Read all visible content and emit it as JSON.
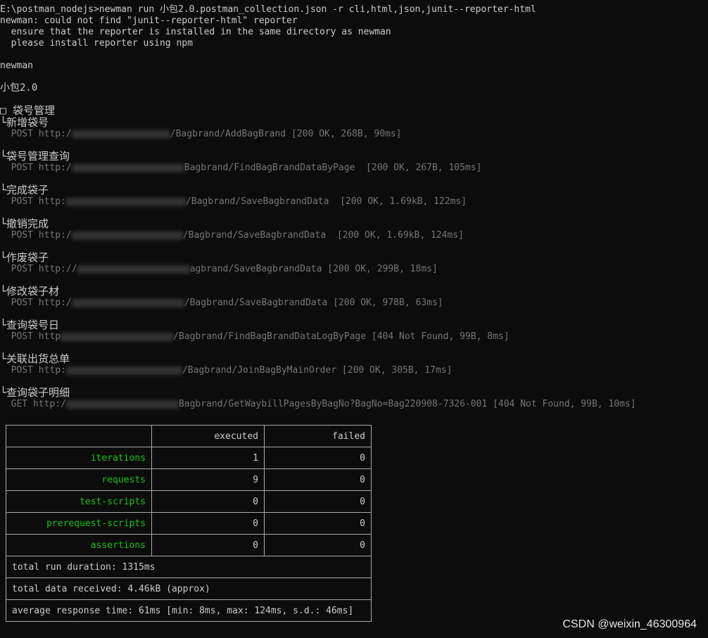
{
  "header": {
    "command": "E:\\postman_nodejs>newman run 小包2.0.postman_collection.json -r cli,html,json,junit--reporter-html",
    "error": "newman: could not find \"junit--reporter-html\" reporter",
    "hint1": "  ensure that the reporter is installed in the same directory as newman",
    "hint2": "  please install reporter using npm",
    "app": "newman",
    "collection": "小包2.0",
    "folder": "□ 袋号管理"
  },
  "requests": [
    {
      "name": "└新增袋号",
      "method": "POST",
      "prefix": "http:/",
      "path": "/Bagbrand/AddBagBrand",
      "result": "[200 OK, 268B, 90ms]"
    },
    {
      "name": "└袋号管理查询",
      "method": "POST",
      "prefix": "http:/",
      "path": "Bagbrand/FindBagBrandDataByPage ",
      "result": "[200 OK, 267B, 105ms]"
    },
    {
      "name": "└完成袋子",
      "method": "POST",
      "prefix": "http:",
      "path": "/Bagbrand/SaveBagbrandData ",
      "result": "[200 OK, 1.69kB, 122ms]"
    },
    {
      "name": "└撤销完成",
      "method": "POST",
      "prefix": "http:/",
      "path": "/Bagbrand/SaveBagbrandData ",
      "result": "[200 OK, 1.69kB, 124ms]"
    },
    {
      "name": "└作废袋子",
      "method": "POST",
      "prefix": "http://",
      "path": "agbrand/SaveBagbrandData",
      "result": "[200 OK, 299B, 18ms]"
    },
    {
      "name": "└修改袋子材",
      "method": "POST",
      "prefix": "http:/",
      "path": "/Bagbrand/SaveBagbrandData",
      "result": "[200 OK, 978B, 63ms]"
    },
    {
      "name": "└查询袋号日",
      "method": "POST",
      "prefix": "http",
      "path": "/Bagbrand/FindBagBrandDataLogByPage",
      "result": "[404 Not Found, 99B, 8ms]"
    },
    {
      "name": "└关联出货总单",
      "method": "POST",
      "prefix": "http:",
      "path": "/Bagbrand/JoinBagByMainOrder",
      "result": "[200 OK, 305B, 17ms]"
    },
    {
      "name": "└查询袋子明细",
      "method": "GET",
      "prefix": "http:/",
      "path": "Bagbrand/GetWaybillPagesByBagNo?BagNo=Bag220908-7326-001",
      "result": "[404 Not Found, 99B, 10ms]"
    }
  ],
  "table": {
    "headers": [
      "",
      "executed",
      "failed"
    ],
    "rows": [
      {
        "label": "iterations",
        "executed": "1",
        "failed": "0"
      },
      {
        "label": "requests",
        "executed": "9",
        "failed": "0"
      },
      {
        "label": "test-scripts",
        "executed": "0",
        "failed": "0"
      },
      {
        "label": "prerequest-scripts",
        "executed": "0",
        "failed": "0"
      },
      {
        "label": "assertions",
        "executed": "0",
        "failed": "0"
      }
    ],
    "duration": "total run duration: 1315ms",
    "received": "total data received: 4.46kB (approx)",
    "response": "average response time: 61ms [min: 8ms, max: 124ms, s.d.: 46ms]"
  },
  "watermark": "CSDN @weixin_46300964",
  "colors": {
    "background": "#0c0c0c",
    "text": "#cccccc",
    "dim": "#767676",
    "green": "#16c60c"
  }
}
